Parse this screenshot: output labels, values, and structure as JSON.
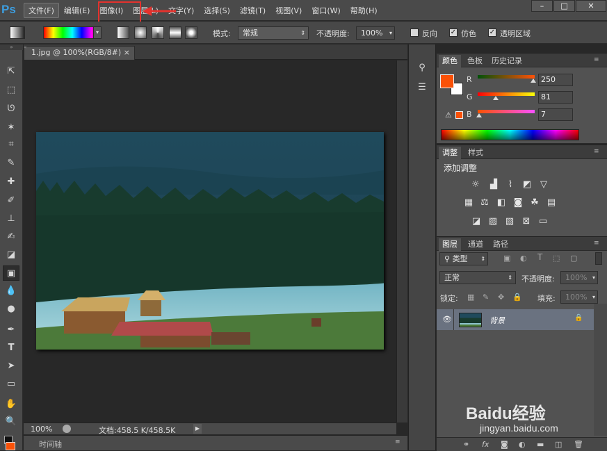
{
  "app": {
    "logo": "Ps"
  },
  "menu": [
    "文件(F)",
    "编辑(E)",
    "图像(I)",
    "图层(L)",
    "文字(Y)",
    "选择(S)",
    "滤镜(T)",
    "视图(V)",
    "窗口(W)",
    "帮助(H)"
  ],
  "window_controls": [
    "–",
    "□",
    "✕"
  ],
  "options_bar": {
    "mode_label": "模式:",
    "mode_value": "常规",
    "opacity_label": "不透明度:",
    "opacity_value": "100%",
    "reverse_label": "反向",
    "dither_label": "仿色",
    "transparency_label": "透明区域",
    "checked": {
      "reverse": false,
      "dither": true,
      "transparency": true
    }
  },
  "document": {
    "tab_title": "1.jpg @ 100%(RGB/8#)",
    "close": "×",
    "zoom": "100%",
    "doc_size": "文档:458.5 K/458.5K"
  },
  "timeline": {
    "label": "时间轴"
  },
  "color_panel": {
    "tabs": [
      "颜色",
      "色板",
      "历史记录"
    ],
    "channels": [
      {
        "label": "R",
        "value": "250",
        "level": 0.98
      },
      {
        "label": "G",
        "value": "81",
        "level": 0.32
      },
      {
        "label": "B",
        "value": "7",
        "level": 0.03
      }
    ],
    "foreground": "#fa5107",
    "background": "#ffffff"
  },
  "adjust_panel": {
    "tabs": [
      "调整",
      "样式"
    ],
    "title": "添加调整"
  },
  "layers_panel": {
    "tabs": [
      "图层",
      "通道",
      "路径"
    ],
    "filter": "类型",
    "blend_mode": "正常",
    "opacity_label": "不透明度:",
    "opacity_value": "100%",
    "lock_label": "锁定:",
    "fill_label": "填充:",
    "fill_value": "100%",
    "layer_name": "背景",
    "bottom_icons": [
      "link-icon",
      "fx-icon",
      "mask-icon",
      "adjustment-icon",
      "group-icon",
      "new-layer-icon",
      "trash-icon"
    ],
    "fx_text": "fx"
  },
  "watermark": {
    "brand": "Baidu经验",
    "url": "jingyan.baidu.com"
  }
}
